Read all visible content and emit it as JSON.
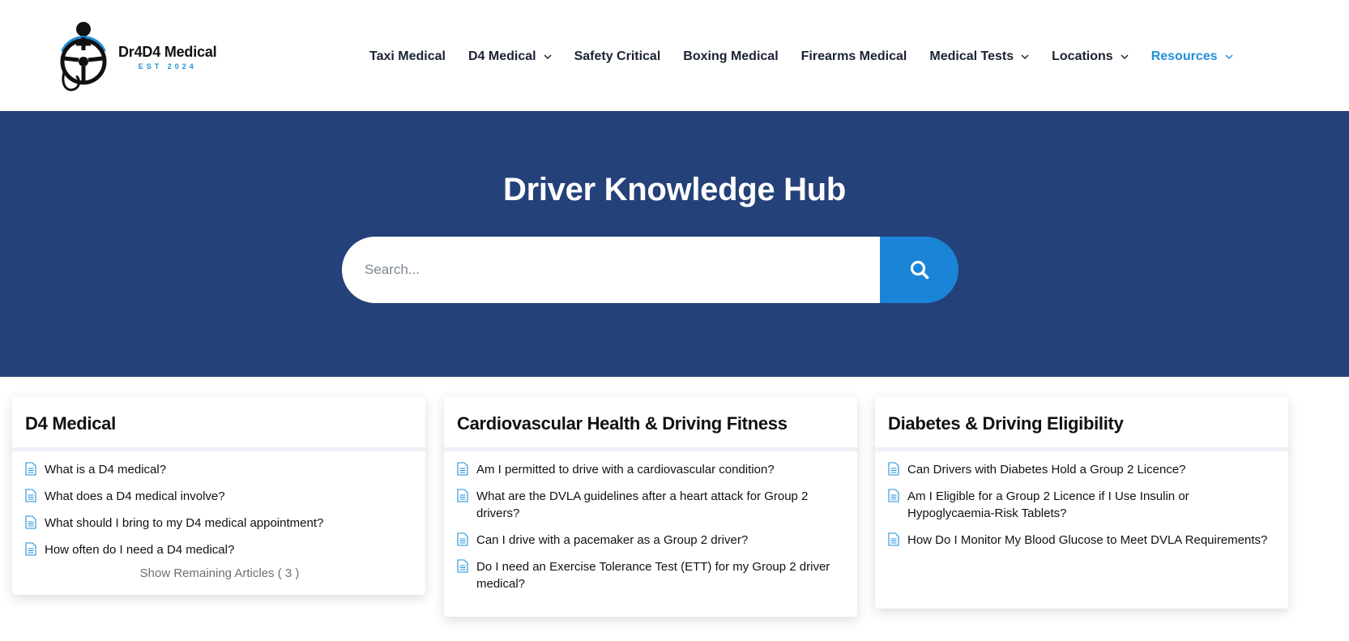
{
  "header": {
    "logo": {
      "name": "Dr4D4 Medical",
      "est": "EST 2024"
    },
    "nav": [
      {
        "label": "Taxi Medical",
        "dropdown": false,
        "active": false
      },
      {
        "label": "D4 Medical",
        "dropdown": true,
        "active": false
      },
      {
        "label": "Safety Critical",
        "dropdown": false,
        "active": false
      },
      {
        "label": "Boxing Medical",
        "dropdown": false,
        "active": false
      },
      {
        "label": "Firearms Medical",
        "dropdown": false,
        "active": false
      },
      {
        "label": "Medical Tests",
        "dropdown": true,
        "active": false
      },
      {
        "label": "Locations",
        "dropdown": true,
        "active": false
      },
      {
        "label": "Resources",
        "dropdown": true,
        "active": true
      }
    ]
  },
  "hero": {
    "title": "Driver Knowledge Hub",
    "search": {
      "placeholder": "Search...",
      "button_icon": "search-icon"
    }
  },
  "categories": [
    {
      "title": "D4 Medical",
      "articles": [
        "What is a D4 medical?",
        "What does a D4 medical involve?",
        "What should I bring to my D4 medical appointment?",
        "How often do I need a D4 medical?"
      ],
      "show_more": "Show Remaining Articles ( 3 )"
    },
    {
      "title": "Cardiovascular Health & Driving Fitness",
      "articles": [
        "Am I permitted to drive with a cardiovascular condition?",
        "What are the DVLA guidelines after a heart attack for Group 2 drivers?",
        "Can I drive with a pacemaker as a Group 2 driver?",
        "Do I need an Exercise Tolerance Test (ETT) for my Group 2 driver medical?"
      ]
    },
    {
      "title": "Diabetes & Driving Eligibility",
      "articles": [
        "Can Drivers with Diabetes Hold a Group 2 Licence?",
        "Am I Eligible for a Group 2 Licence if I Use Insulin or Hypoglycaemia-Risk Tablets?",
        "How Do I Monitor My Blood Glucose to Meet DVLA Requirements?"
      ]
    }
  ],
  "colors": {
    "hero_bg": "#254179",
    "accent": "#1a85d6",
    "active_nav": "#1f8fd8"
  }
}
